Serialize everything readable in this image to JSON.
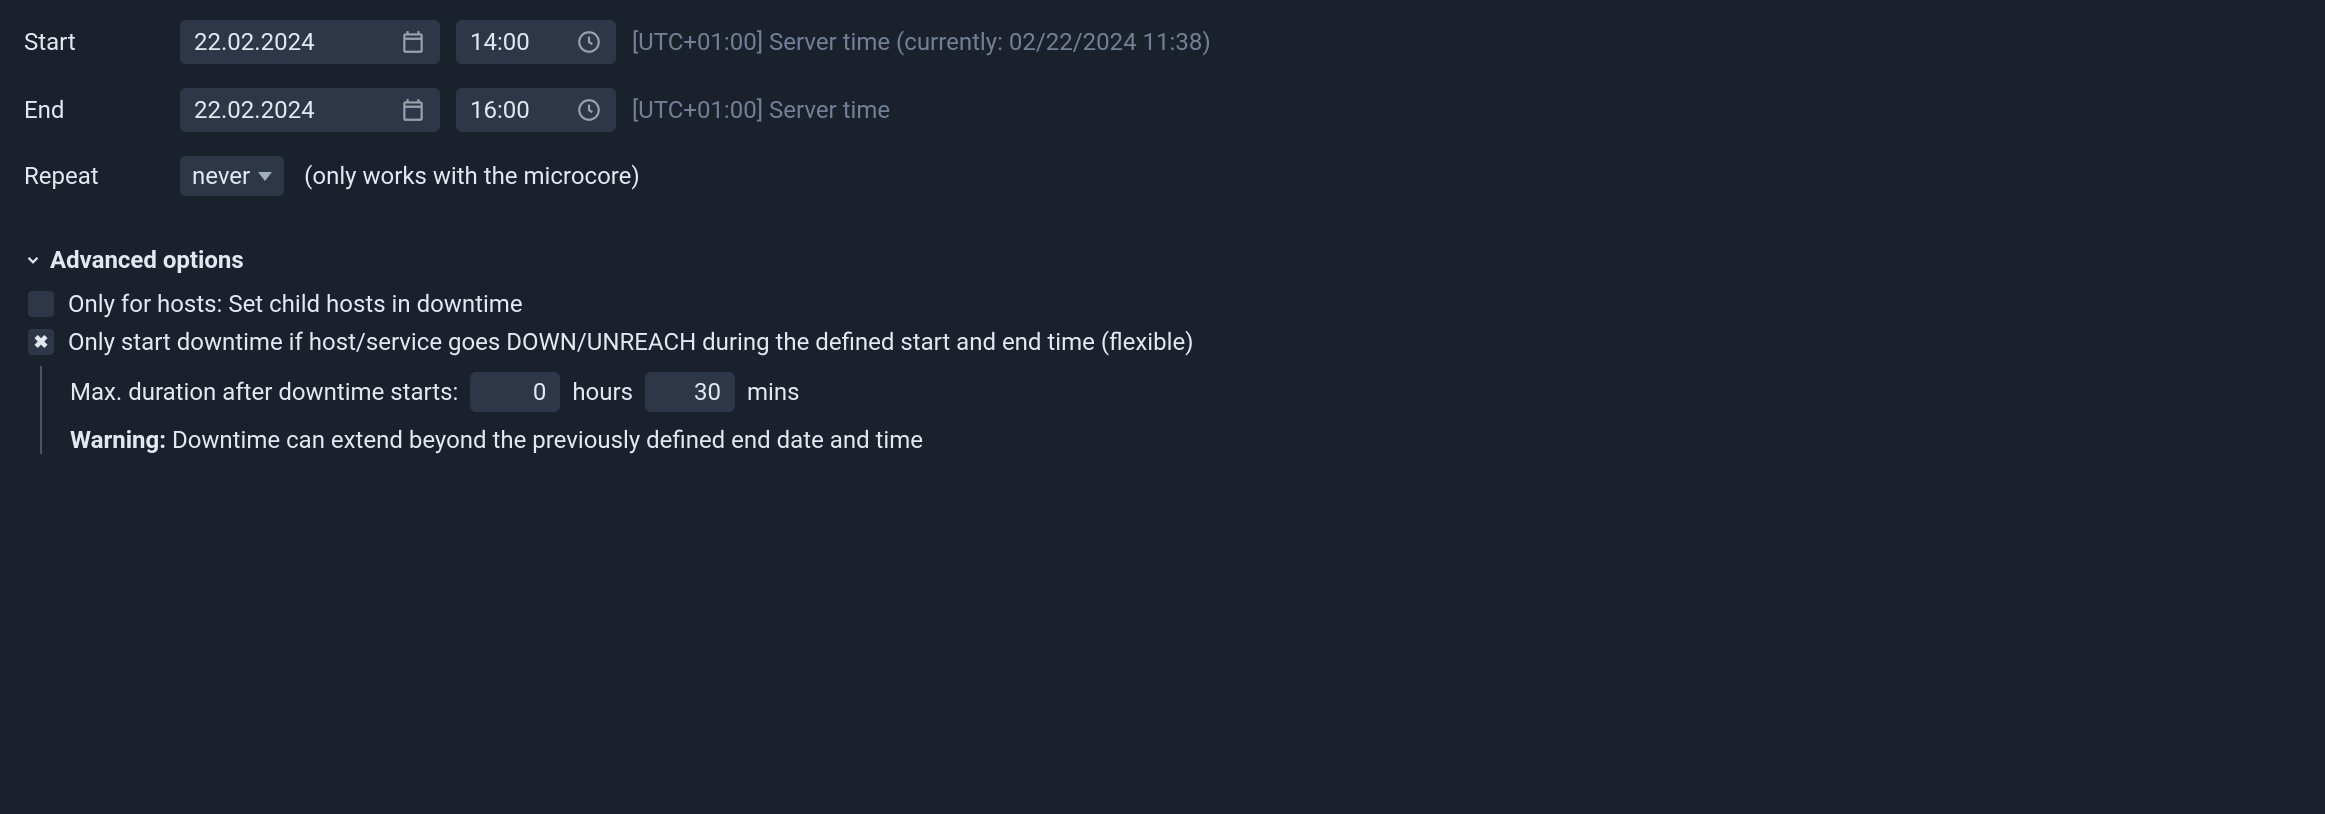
{
  "start": {
    "label": "Start",
    "date": "22.02.2024",
    "time": "14:00",
    "hint": "[UTC+01:00] Server time (currently: 02/22/2024 11:38)"
  },
  "end": {
    "label": "End",
    "date": "22.02.2024",
    "time": "16:00",
    "hint": "[UTC+01:00] Server time"
  },
  "repeat": {
    "label": "Repeat",
    "value": "never",
    "hint": "(only works with the microcore)"
  },
  "advanced": {
    "title": "Advanced options",
    "child_hosts": {
      "checked": false,
      "label": "Only for hosts: Set child hosts in downtime"
    },
    "flexible": {
      "checked": true,
      "label": "Only start downtime if host/service goes DOWN/UNREACH during the defined start and end time (flexible)"
    },
    "duration": {
      "label": "Max. duration after downtime starts:",
      "hours": "0",
      "hours_unit": "hours",
      "mins": "30",
      "mins_unit": "mins"
    },
    "warning": {
      "label": "Warning:",
      "text": " Downtime can extend beyond the previously defined end date and time"
    }
  }
}
